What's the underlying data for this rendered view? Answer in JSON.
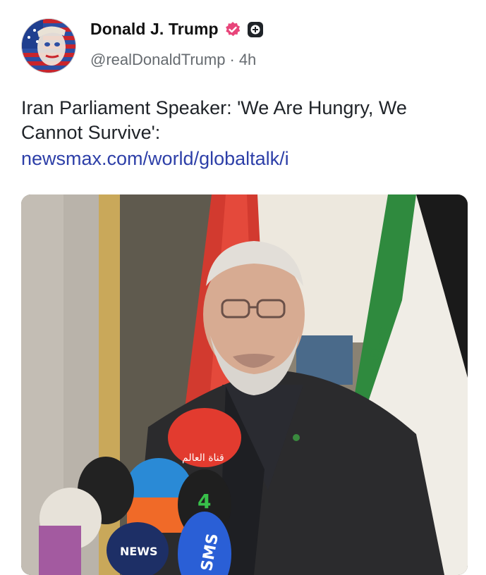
{
  "post": {
    "author_name": "Donald J. Trump",
    "handle": "@realDonaldTrump",
    "separator": "·",
    "time_ago": "4h",
    "text": "Iran Parliament Speaker: 'We Are Hungry, We Cannot Survive':",
    "link_text": "newsmax.com/world/globaltalk/i"
  },
  "icons": {
    "verified": "verified-badge-icon",
    "plus": "plus-badge-icon",
    "avatar": "avatar-image"
  },
  "colors": {
    "verified_badge": "#e8457a",
    "link": "#2d3fa8",
    "secondary_text": "#666b70"
  },
  "media": {
    "microphone_logos": [
      "قناة العالم",
      "NEWS",
      "SMS"
    ]
  }
}
